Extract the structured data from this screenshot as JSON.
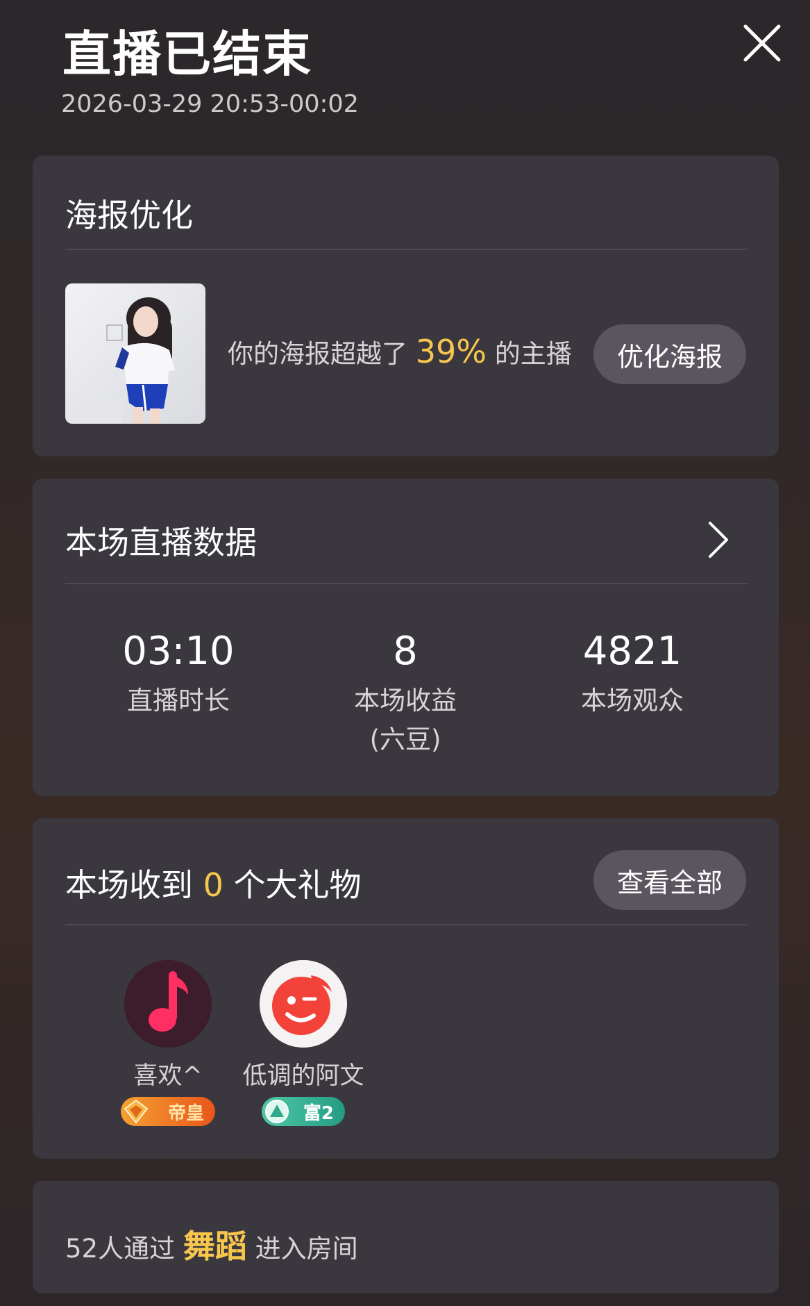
{
  "header": {
    "title": "直播已结束",
    "datetime": "2026-03-29 20:53-00:02"
  },
  "poster": {
    "title": "海报优化",
    "text_before": "你的海报超越了",
    "percent": "39%",
    "text_after": "的主播",
    "button": "优化海报"
  },
  "live_data": {
    "title": "本场直播数据",
    "stats": [
      {
        "value": "03:10",
        "label": "直播时长",
        "sub": ""
      },
      {
        "value": "8",
        "label": "本场收益",
        "sub": "(六豆)"
      },
      {
        "value": "4821",
        "label": "本场观众",
        "sub": ""
      }
    ]
  },
  "gifts": {
    "title_before": "本场收到",
    "count": "0",
    "title_after": "个大礼物",
    "button": "查看全部",
    "gifters": [
      {
        "name": "喜欢^",
        "badge": "帝皇",
        "badge_color": "#f07a25"
      },
      {
        "name": "低调的阿文",
        "badge": "富2",
        "badge_color": "#2ea98a"
      }
    ]
  },
  "footer": {
    "text_before": "52人通过",
    "highlight": "舞蹈",
    "text_after": "进入房间"
  },
  "colors": {
    "accent": "#f7c64f",
    "card": "#3a373e",
    "button": "#5b5560"
  }
}
